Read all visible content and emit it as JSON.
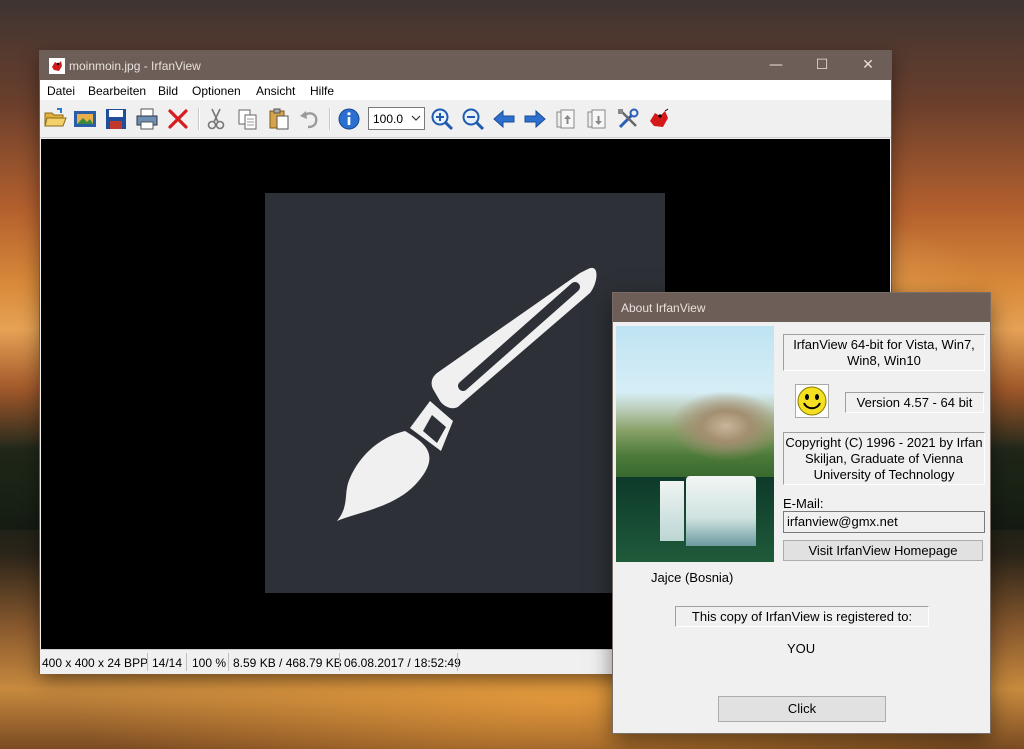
{
  "window": {
    "title": "moinmoin.jpg - IrfanView",
    "controls": {
      "minimize": "—",
      "maximize": "☐",
      "close": "✕"
    }
  },
  "menu": [
    "Datei",
    "Bearbeiten",
    "Bild",
    "Optionen",
    "Ansicht",
    "Hilfe"
  ],
  "toolbar": {
    "icons": [
      "open-folder-icon",
      "slideshow-icon",
      "save-icon",
      "print-icon",
      "delete-icon",
      "cut-icon",
      "copy-icon",
      "paste-icon",
      "undo-icon",
      "info-icon",
      "zoom-in-icon",
      "zoom-out-icon",
      "previous-arrow-icon",
      "next-arrow-icon",
      "first-page-icon",
      "last-page-icon",
      "settings-tools-icon",
      "irfanview-logo-icon"
    ],
    "zoom_value": "100.0"
  },
  "status": {
    "dimensions": "400 x 400 x 24 BPP",
    "index": "14/14",
    "zoom": "100 %",
    "size": "8.59 KB / 468.79 KB",
    "datetime": "06.08.2017 / 18:52:49"
  },
  "about": {
    "title": "About  IrfanView",
    "product": "IrfanView 64-bit for Vista, Win7, Win8, Win10",
    "version": "Version 4.57 - 64 bit",
    "copyright": "Copyright (C) 1996 - 2021 by Irfan Skiljan, Graduate of Vienna University of Technology",
    "email_label": "E-Mail:",
    "email": "irfanview@gmx.net",
    "homepage_button": "Visit IrfanView Homepage",
    "photo_caption": "Jajce (Bosnia)",
    "registered_label": "This copy of IrfanView is registered to:",
    "registered_to": "YOU",
    "click_button": "Click"
  },
  "colors": {
    "titlebar": "#6e5e58",
    "canvas_bg": "#2d3036",
    "brush": "#f0f0f0"
  }
}
